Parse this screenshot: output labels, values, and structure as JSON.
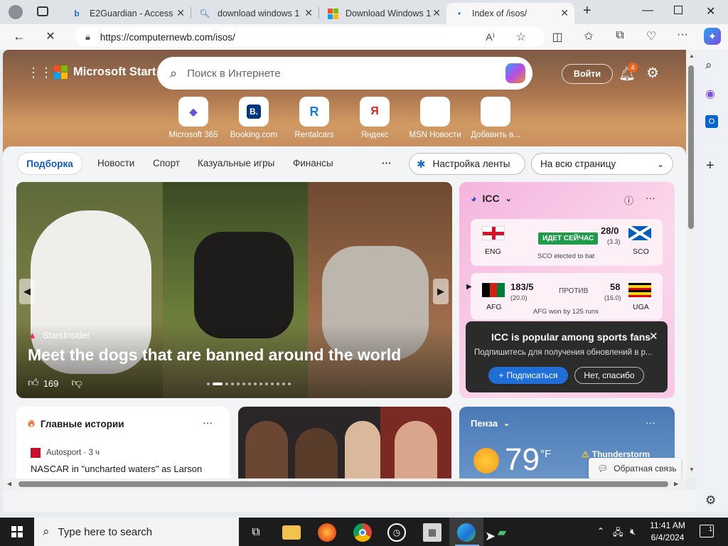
{
  "browser": {
    "tabs": [
      {
        "title": "E2Guardian - Access",
        "icon": "bing-icon"
      },
      {
        "title": "download windows 1",
        "icon": "search-icon"
      },
      {
        "title": "Download Windows 1",
        "icon": "microsoft-logo-icon"
      },
      {
        "title": "Index of /isos/",
        "icon": "loading-icon",
        "active": true
      }
    ],
    "url": "https://computernewb.com/isos/"
  },
  "header": {
    "brand": "Microsoft Start",
    "search_placeholder": "Поиск в Интернете",
    "signin_label": "Войти",
    "notification_count": "4"
  },
  "quicklinks": [
    {
      "label": "Microsoft 365",
      "glyph": "◆",
      "color": "#6b4fd8"
    },
    {
      "label": "Booking.com",
      "glyph": "B.",
      "color": "#003580"
    },
    {
      "label": "Rentalcars",
      "glyph": "R",
      "color": "#1f7ad6"
    },
    {
      "label": "Яндекс",
      "glyph": "Я",
      "color": "#d22"
    },
    {
      "label": "MSN Новости",
      "glyph": "▤",
      "color": "#222"
    },
    {
      "label": "Добавить в...",
      "glyph": "+",
      "color": "#333"
    }
  ],
  "nav": {
    "active": "Подборка",
    "items": [
      "Новости",
      "Спорт",
      "Казуальные игры",
      "Финансы"
    ],
    "more": "···",
    "feed_settings": "Настройка ленты",
    "layout_select": "На всю страницу"
  },
  "hero_story": {
    "source": "StarsInsider",
    "headline": "Meet the dogs that are banned around the world",
    "likes": "169"
  },
  "icc": {
    "title": "ICC",
    "matches": [
      {
        "team1": "ENG",
        "status": "ИДЕТ СЕЙЧАС",
        "score2": "28/0",
        "overs2": "(3.3)",
        "team2": "SCO",
        "note": "SCO elected to bat"
      },
      {
        "team1": "AFG",
        "score1": "183/5",
        "overs1": "(20.0)",
        "status": "ПРОТИВ",
        "score2": "58",
        "overs2": "(16.0)",
        "team2": "UGA",
        "note": "AFG won by 125 runs"
      }
    ],
    "popup": {
      "title": "ICC is popular among sports fans",
      "text": "Подпишитесь для получения обновлений в р...",
      "subscribe": "Подписаться",
      "decline": "Нет, спасибо"
    }
  },
  "top_stories": {
    "title": "Главные истории",
    "source": "Autosport · 3 ч",
    "headline": "NASCAR in \"uncharted waters\" as Larson"
  },
  "weather": {
    "city": "Пенза",
    "temp": "79",
    "unit": "°F",
    "condition": "Thunderstorm",
    "feedback": "Обратная связь"
  },
  "taskbar": {
    "search_placeholder": "Type here to search",
    "time": "11:41 AM",
    "date": "6/4/2024",
    "notification_count": "1"
  },
  "colors": {
    "accent": "#1558b6",
    "popup_bg": "#2b2b2b",
    "subscribe_btn": "#1f6fd6"
  }
}
